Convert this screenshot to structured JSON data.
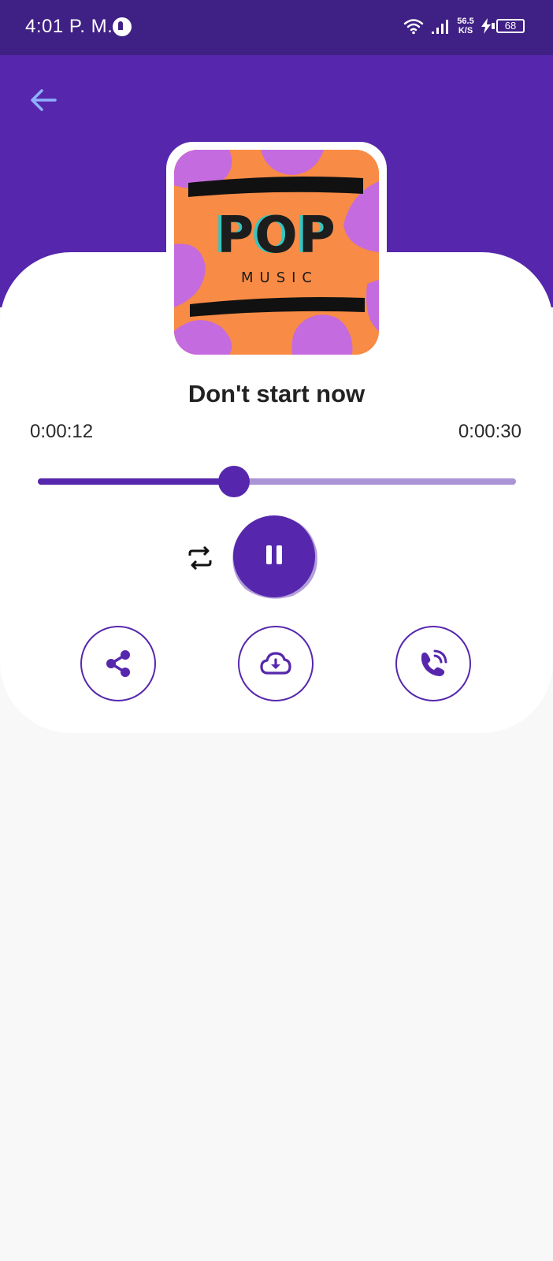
{
  "status_bar": {
    "time": "4:01 P. M.",
    "network_speed_value": "56.5",
    "network_speed_unit": "K/S",
    "battery_level": "68",
    "icons": [
      "app-notification-icon",
      "wifi-icon",
      "signal-icon",
      "charging-bolt-icon",
      "battery-icon"
    ]
  },
  "header": {
    "back_icon": "arrow-left-icon",
    "back_icon_color": "#8fb0ff",
    "background_color": "#5627ad"
  },
  "album_art": {
    "title": "POP",
    "subtitle": "MUSIC",
    "colors": {
      "orange": "#f88b45",
      "violet": "#c46be0",
      "teal": "#34c6c2",
      "text": "#1d1d1d"
    }
  },
  "player": {
    "song_title": "Don't start now",
    "elapsed": "0:00:12",
    "total": "0:00:30",
    "progress_fraction": 0.41,
    "repeat_icon": "repeat-icon",
    "pause_icon": "pause-icon",
    "accent_color": "#5627ad",
    "track_color": "#ab94d6"
  },
  "actions": [
    {
      "name": "share",
      "icon": "share-icon"
    },
    {
      "name": "download",
      "icon": "cloud-download-icon"
    },
    {
      "name": "call",
      "icon": "phone-call-icon"
    }
  ]
}
